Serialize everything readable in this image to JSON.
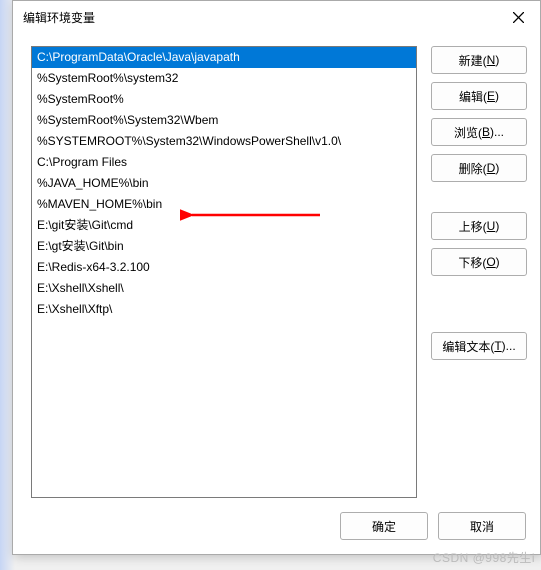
{
  "dialog": {
    "title": "编辑环境变量"
  },
  "list": {
    "items": [
      "C:\\ProgramData\\Oracle\\Java\\javapath",
      "%SystemRoot%\\system32",
      "%SystemRoot%",
      "%SystemRoot%\\System32\\Wbem",
      "%SYSTEMROOT%\\System32\\WindowsPowerShell\\v1.0\\",
      "C:\\Program Files",
      "%JAVA_HOME%\\bin",
      "%MAVEN_HOME%\\bin",
      "E:\\git安装\\Git\\cmd",
      "E:\\gt安装\\Git\\bin",
      "E:\\Redis-x64-3.2.100",
      "E:\\Xshell\\Xshell\\",
      "E:\\Xshell\\Xftp\\"
    ],
    "selected_index": 0
  },
  "buttons": {
    "new": "新建(",
    "new_u": "N",
    "new_end": ")",
    "edit": "编辑(",
    "edit_u": "E",
    "edit_end": ")",
    "browse": "浏览(",
    "browse_u": "B",
    "browse_end": ")...",
    "delete": "删除(",
    "delete_u": "D",
    "delete_end": ")",
    "moveup": "上移(",
    "moveup_u": "U",
    "moveup_end": ")",
    "movedown": "下移(",
    "movedown_u": "O",
    "movedown_end": ")",
    "edittext": "编辑文本(",
    "edittext_u": "T",
    "edittext_end": ")...",
    "ok": "确定",
    "cancel": "取消"
  },
  "watermark": "CSDN @998先生i"
}
